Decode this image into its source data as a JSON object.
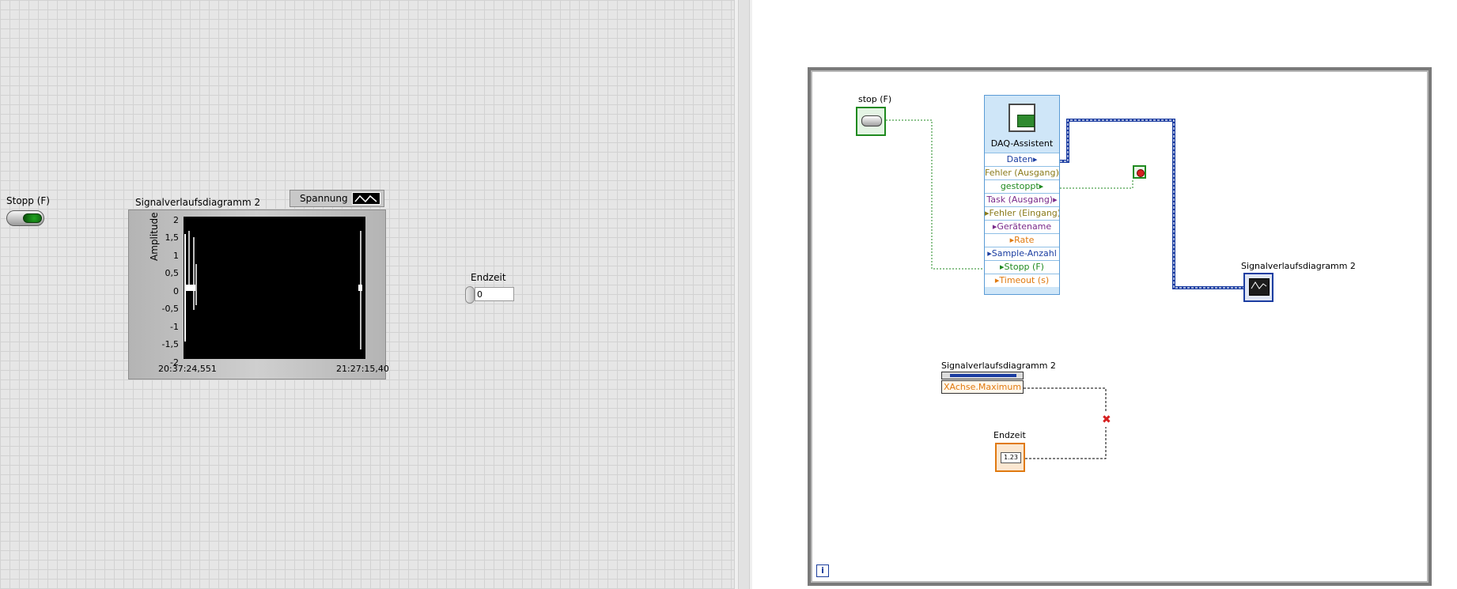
{
  "front_panel": {
    "stop_label": "Stopp (F)",
    "chart": {
      "label": "Signalverlaufsdiagramm 2",
      "plot_legend": "Spannung",
      "ylabel": "Amplitude",
      "yticks": [
        "2",
        "1,5",
        "1",
        "0,5",
        "0",
        "-0,5",
        "-1",
        "-1,5",
        "-2"
      ],
      "xtick_start": "20:37:24,551",
      "xtick_end": "21:27:15,40"
    },
    "endzeit_label": "Endzeit",
    "endzeit_value": "0"
  },
  "block_diagram": {
    "stop_label": "stop (F)",
    "daq": {
      "title": "DAQ-Assistent",
      "terminals": [
        {
          "label": "Daten",
          "color": "#1b3da1",
          "dir": "out"
        },
        {
          "label": "Fehler (Ausgang)",
          "color": "#8a7a1a",
          "dir": "out"
        },
        {
          "label": "gestoppt",
          "color": "#1f8a1f",
          "dir": "out"
        },
        {
          "label": "Task (Ausgang)",
          "color": "#7a2a8a",
          "dir": "out"
        },
        {
          "label": "Fehler (Eingang)",
          "color": "#8a7a1a",
          "dir": "in"
        },
        {
          "label": "Gerätename",
          "color": "#7a2a8a",
          "dir": "in"
        },
        {
          "label": "Rate",
          "color": "#e07a10",
          "dir": "in"
        },
        {
          "label": "Sample-Anzahl",
          "color": "#1b3da1",
          "dir": "in"
        },
        {
          "label": "Stopp (F)",
          "color": "#1f8a1f",
          "dir": "in"
        },
        {
          "label": "Timeout (s)",
          "color": "#e07a10",
          "dir": "in"
        }
      ]
    },
    "chart_label": "Signalverlaufsdiagramm 2",
    "property_node": {
      "label": "Signalverlaufsdiagramm 2",
      "property": "XAchse.Maximum"
    },
    "endzeit_label": "Endzeit",
    "endzeit_display": "1.23",
    "loop_iteration": "i"
  }
}
